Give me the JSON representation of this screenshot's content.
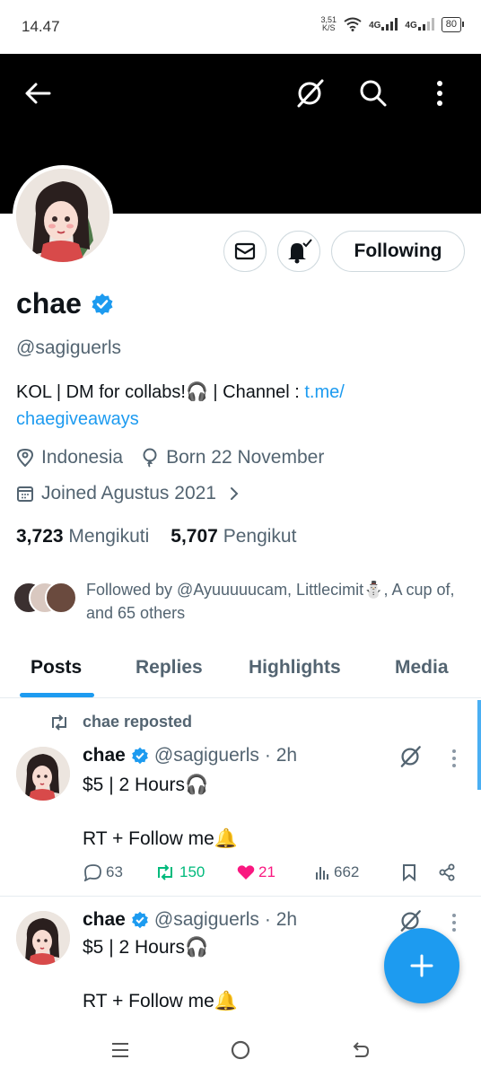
{
  "status_bar": {
    "time": "14.47",
    "net_speed": "3,51",
    "net_unit": "K/S",
    "sig1": "4G",
    "sig2": "4G",
    "battery": "80"
  },
  "banner": {
    "back_icon": "arrow-left-icon",
    "grok_icon": "slashed-circle-icon",
    "search_icon": "search-icon",
    "more_icon": "kebab-menu-icon"
  },
  "profile": {
    "display_name": "chae",
    "handle": "@sagiguerls",
    "bio_text": "KOL | DM for collabs!🎧 | Channel : ",
    "bio_link_1": "t.me/",
    "bio_link_2": "chaegiveaways",
    "location": "Indonesia",
    "birthday": "Born 22 November",
    "joined": "Joined Agustus 2021",
    "following_count": "3,723",
    "following_label": "Mengikuti",
    "followers_count": "5,707",
    "followers_label": "Pengikut",
    "followed_by": "Followed by @Ayuuuuucam, Littlecimit⛄, A cup of, and 65 others",
    "following_button": "Following",
    "verified_color": "#1d9bf0"
  },
  "tabs": [
    "Posts",
    "Replies",
    "Highlights",
    "Media"
  ],
  "posts": [
    {
      "repost_label": "chae reposted",
      "name": "chae",
      "handle": "@sagiguerls",
      "time": "· 2h",
      "line1": "$5 | 2 Hours🎧",
      "line2": "RT + Follow me🔔",
      "replies": "63",
      "reposts": "150",
      "likes": "21",
      "views": "662"
    },
    {
      "name": "chae",
      "handle": "@sagiguerls",
      "time": "· 2h",
      "line1": "$5 | 2 Hours🎧",
      "line2": "RT + Follow me🔔"
    }
  ],
  "colors": {
    "accent": "#1d9bf0",
    "repost_green": "#00ba7c",
    "like_pink": "#f91880",
    "text_gray": "#536471"
  }
}
